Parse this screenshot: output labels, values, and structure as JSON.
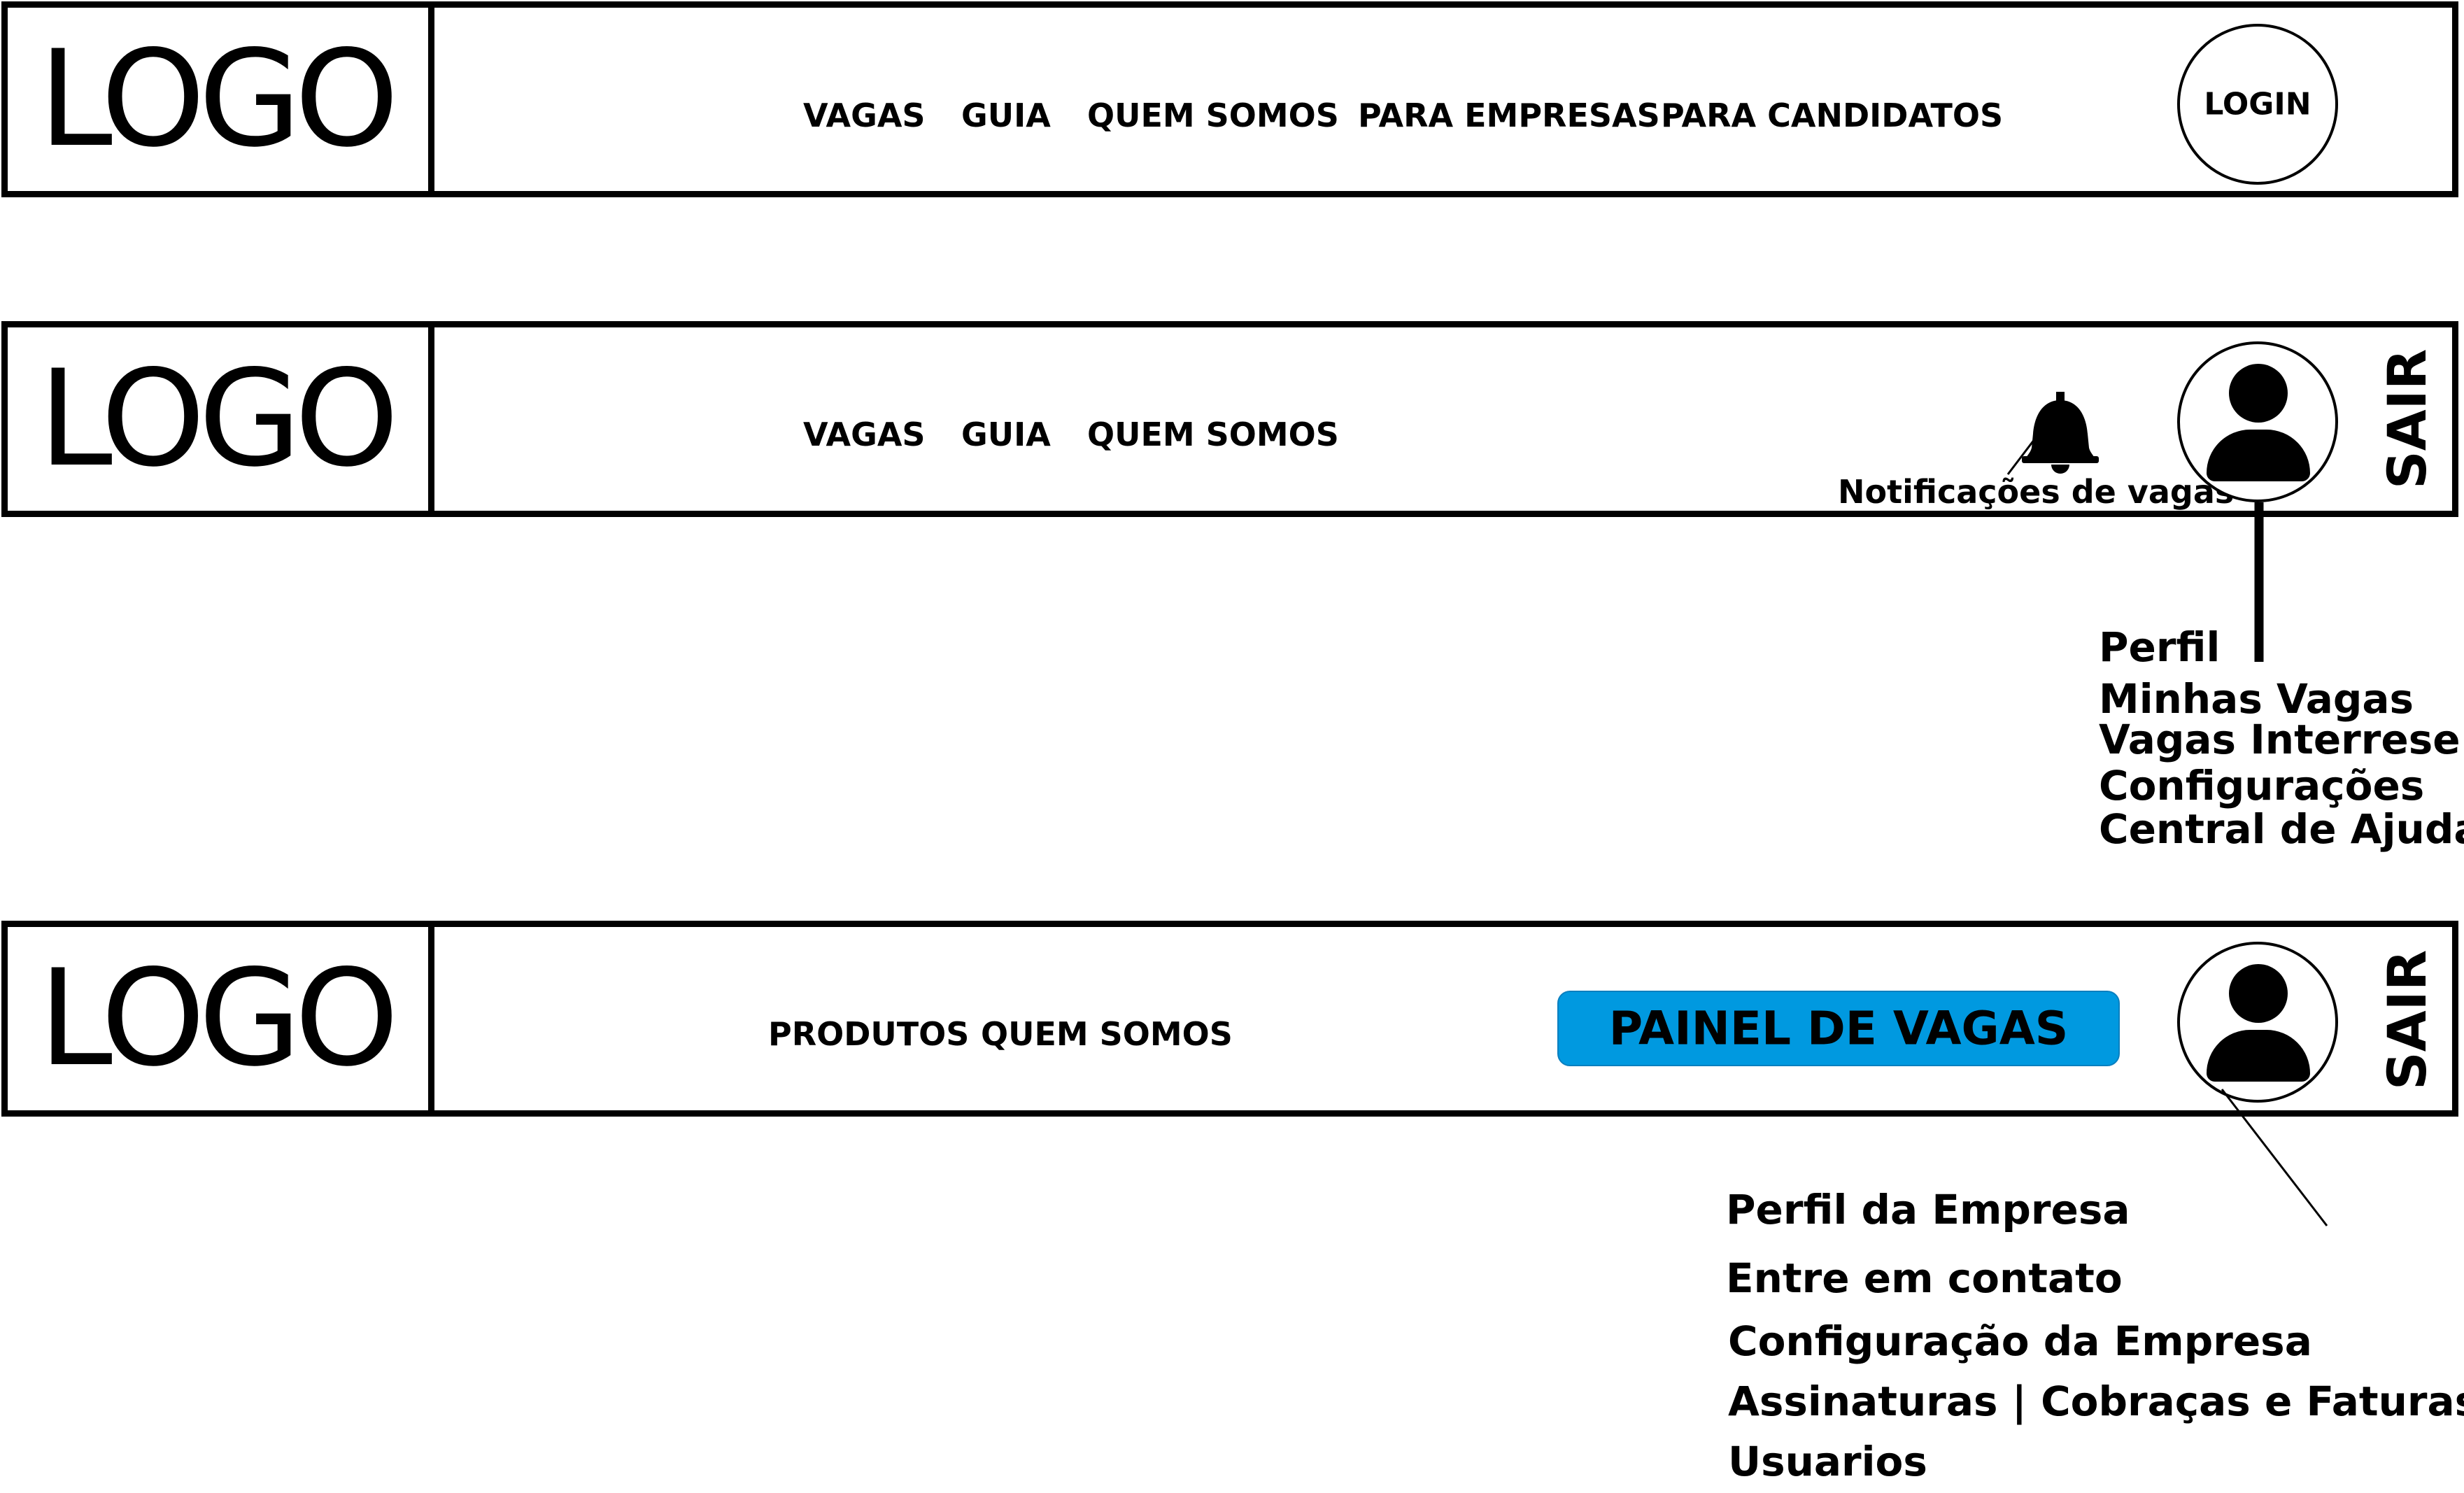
{
  "bar1": {
    "logo": "LOGO",
    "nav": [
      "VAGAS",
      "GUIA",
      "QUEM SOMOS",
      "PARA EMPRESAS",
      "PARA CANDIDATOS"
    ],
    "login": "LOGIN"
  },
  "bar2": {
    "logo": "LOGO",
    "nav": [
      "VAGAS",
      "GUIA",
      "QUEM SOMOS"
    ],
    "notification_label": "Notificações de vagas",
    "sair": "SAIR",
    "menu": [
      "Perfil",
      "Minhas Vagas",
      "Vagas Interrese ?",
      "Configurações",
      "Central de Ajuda"
    ]
  },
  "bar3": {
    "logo": "LOGO",
    "nav": [
      "PRODUTOS",
      "QUEM SOMOS"
    ],
    "button": "PAINEL DE VAGAS",
    "sair": "SAIR",
    "menu": [
      "Perfil da Empresa",
      "Entre em contato",
      "Configuração da Empresa",
      "Assinaturas | Cobraças e Faturas",
      "Usuarios"
    ]
  },
  "colors": {
    "button_background": "#0099e0",
    "lines": "#000000"
  },
  "icons": [
    "bell-icon",
    "user-icon"
  ]
}
